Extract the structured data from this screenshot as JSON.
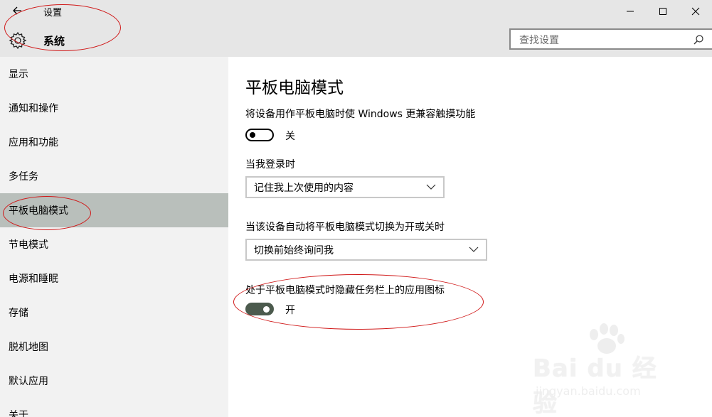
{
  "header": {
    "app_title": "设置",
    "section_title": "系统",
    "search": {
      "placeholder": "查找设置"
    }
  },
  "icons": {
    "back": "back-arrow-icon",
    "gear": "gear-icon",
    "minimize": "minimize-icon",
    "maximize": "maximize-icon",
    "close": "close-icon",
    "search": "search-icon",
    "dropdown": "chevron-down-icon"
  },
  "sidebar": {
    "items": [
      {
        "label": "显示"
      },
      {
        "label": "通知和操作"
      },
      {
        "label": "应用和功能"
      },
      {
        "label": "多任务"
      },
      {
        "label": "平板电脑模式",
        "active": true
      },
      {
        "label": "节电模式"
      },
      {
        "label": "电源和睡眠"
      },
      {
        "label": "存储"
      },
      {
        "label": "脱机地图"
      },
      {
        "label": "默认应用"
      },
      {
        "label": "关于"
      }
    ]
  },
  "main": {
    "page_title": "平板电脑模式",
    "touch_setting": {
      "label": "将设备用作平板电脑时使 Windows 更兼容触摸功能",
      "state_text": "关",
      "on": false
    },
    "signin": {
      "label": "当我登录时",
      "selected": "记住我上次使用的内容"
    },
    "auto_switch": {
      "label": "当该设备自动将平板电脑模式切换为开或关时",
      "selected": "切换前始终询问我"
    },
    "hide_icons": {
      "label": "处于平板电脑模式时隐藏任务栏上的应用图标",
      "state_text": "开",
      "on": true
    }
  },
  "watermark": {
    "brand": "Bai du 经验",
    "url": "jingyan.baidu.com"
  },
  "colors": {
    "header_bg": "#e6e6e6",
    "sidebar_bg": "#f2f2f2",
    "active_item_bg": "#b9bfbb",
    "toggle_on": "#4b5a4d",
    "annotation_red": "#d01818"
  }
}
